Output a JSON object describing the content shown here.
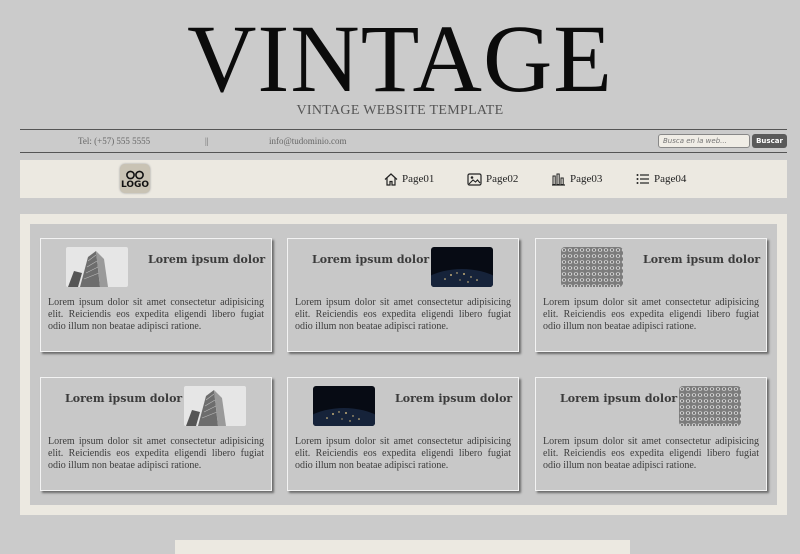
{
  "header": {
    "title": "VINTAGE",
    "subtitle": "VINTAGE WEBSITE TEMPLATE"
  },
  "contact": {
    "tel": "Tel: (+57) 555 5555",
    "separator": "||",
    "email": "info@tudominio.com",
    "search_placeholder": "Busca en la web...",
    "search_button": "Buscar"
  },
  "nav": {
    "logo_text": "LOGO",
    "items": [
      {
        "label": "Page01",
        "icon": "home-icon"
      },
      {
        "label": "Page02",
        "icon": "image-icon"
      },
      {
        "label": "Page03",
        "icon": "chart-icon"
      },
      {
        "label": "Page04",
        "icon": "list-icon"
      }
    ]
  },
  "cards": [
    {
      "title": "Lorem ipsum dolor",
      "image": "skyscraper",
      "text": "Lorem ipsum dolor sit amet consectetur adipisicing elit. Reiciendis eos expedita eligendi libero fugiat odio illum non beatae adipisci ratione."
    },
    {
      "title": "Lorem ipsum dolor",
      "image": "earth-night",
      "text": "Lorem ipsum dolor sit amet consectetur adipisicing elit. Reiciendis eos expedita eligendi libero fugiat odio illum non beatae adipisci ratione."
    },
    {
      "title": "Lorem ipsum dolor",
      "image": "building-facade",
      "text": "Lorem ipsum dolor sit amet consectetur adipisicing elit. Reiciendis eos expedita eligendi libero fugiat odio illum non beatae adipisci ratione."
    },
    {
      "title": "Lorem ipsum dolor",
      "image": "skyscraper",
      "text": "Lorem ipsum dolor sit amet consectetur adipisicing elit. Reiciendis eos expedita eligendi libero fugiat odio illum non beatae adipisci ratione."
    },
    {
      "title": "Lorem ipsum dolor",
      "image": "earth-night",
      "text": "Lorem ipsum dolor sit amet consectetur adipisicing elit. Reiciendis eos expedita eligendi libero fugiat odio illum non beatae adipisci ratione."
    },
    {
      "title": "Lorem ipsum dolor",
      "image": "building-facade",
      "text": "Lorem ipsum dolor sit amet consectetur adipisicing elit. Reiciendis eos expedita eligendi libero fugiat odio illum non beatae adipisci ratione."
    }
  ],
  "colors": {
    "page_bg": "#cbcbcb",
    "panel_bg": "#ece9e1",
    "card_bg": "#c8c8c8",
    "title": "#0b0b0b",
    "button_bg": "#5a5a5a"
  }
}
